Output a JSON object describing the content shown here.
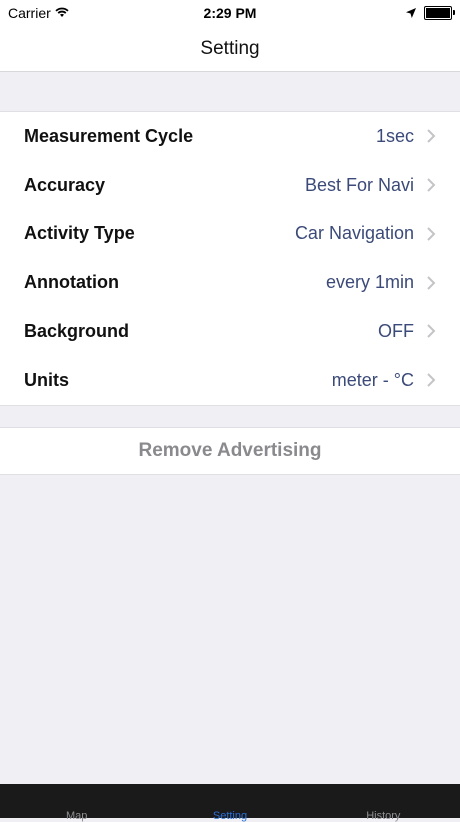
{
  "status": {
    "carrier": "Carrier",
    "time": "2:29 PM"
  },
  "nav": {
    "title": "Setting"
  },
  "settings": [
    {
      "label": "Measurement Cycle",
      "value": "1sec"
    },
    {
      "label": "Accuracy",
      "value": "Best For Navi"
    },
    {
      "label": "Activity Type",
      "value": "Car Navigation"
    },
    {
      "label": "Annotation",
      "value": "every 1min"
    },
    {
      "label": "Background",
      "value": "OFF"
    },
    {
      "label": "Units",
      "value": "meter - °C"
    }
  ],
  "remove_ad": {
    "label": "Remove Advertising"
  },
  "tabs": [
    {
      "label": "Map",
      "active": false
    },
    {
      "label": "Setting",
      "active": true
    },
    {
      "label": "History",
      "active": false
    }
  ],
  "colors": {
    "accent": "#2b6fd6",
    "value_text": "#3b4a78",
    "background": "#efeff4"
  }
}
